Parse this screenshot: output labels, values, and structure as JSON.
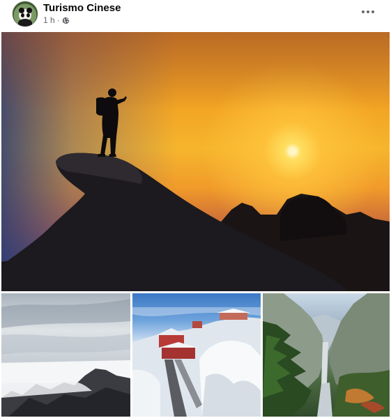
{
  "post": {
    "page_name": "Turismo Cinese",
    "time": "1 h",
    "separator": "·",
    "privacy_icon": "globe-icon",
    "more_icon": "more-options-icon"
  },
  "photos": [
    {
      "subject": "hiker on rock at sunset"
    },
    {
      "subject": "sea of clouds over mountains"
    },
    {
      "subject": "snowy temple on mountain"
    },
    {
      "subject": "mountain valley stairway"
    }
  ],
  "colors": {
    "text_primary": "#050505",
    "text_secondary": "#65676b",
    "sunset_orange": "#f6b52d"
  }
}
